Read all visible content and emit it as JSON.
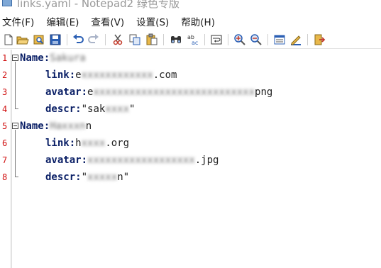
{
  "window": {
    "title": "links.yaml - Notepad2 绿色专版"
  },
  "menubar": {
    "items": [
      {
        "label": "文件(F)"
      },
      {
        "label": "编辑(E)"
      },
      {
        "label": "查看(V)"
      },
      {
        "label": "设置(S)"
      },
      {
        "label": "帮助(H)"
      }
    ]
  },
  "toolbar": {
    "buttons": [
      {
        "name": "new-icon"
      },
      {
        "name": "open-icon"
      },
      {
        "name": "browse-icon"
      },
      {
        "name": "save-icon"
      },
      {
        "name": "undo-icon"
      },
      {
        "name": "redo-icon"
      },
      {
        "name": "cut-icon"
      },
      {
        "name": "copy-icon"
      },
      {
        "name": "paste-icon"
      },
      {
        "name": "find-icon"
      },
      {
        "name": "replace-icon"
      },
      {
        "name": "word-wrap-icon"
      },
      {
        "name": "zoom-in-icon"
      },
      {
        "name": "zoom-out-icon"
      },
      {
        "name": "select-scheme-icon"
      },
      {
        "name": "customize-scheme-icon"
      },
      {
        "name": "exit-icon"
      }
    ],
    "colors": {
      "blue": "#2b5fb4",
      "yellow": "#e8b84a",
      "red": "#c23a2a"
    }
  },
  "editor": {
    "line_number_color": "#d01010",
    "key_color": "#0a1f66",
    "lines": [
      {
        "num": "1",
        "key": "Name",
        "colon": ":",
        "value_visible": "",
        "value_blurred": "Sakura",
        "value_tail": ""
      },
      {
        "num": "2",
        "key": "link",
        "colon": ":",
        "value_visible": "e",
        "value_blurred": "xxxxxxxxxxxx",
        "value_tail": ".com"
      },
      {
        "num": "3",
        "key": "avatar",
        "colon": ":",
        "value_visible": "e",
        "value_blurred": "xxxxxxxxxxxxxxxxxxxxxxxxxxx",
        "value_tail": "png"
      },
      {
        "num": "4",
        "key": "descr",
        "colon": ":",
        "value_visible": "\"sak",
        "value_blurred": "xxxx",
        "value_tail": "\""
      },
      {
        "num": "5",
        "key": "Name",
        "colon": ":",
        "value_visible": "",
        "value_blurred": "Haxxxn",
        "value_tail": "n"
      },
      {
        "num": "6",
        "key": "link",
        "colon": ":",
        "value_visible": "h",
        "value_blurred": "xxxx",
        "value_tail": ".org"
      },
      {
        "num": "7",
        "key": "avatar",
        "colon": ":",
        "value_visible": "",
        "value_blurred": "xxxxxxxxxxxxxxxxxx",
        "value_tail": ".jpg"
      },
      {
        "num": "8",
        "key": "descr",
        "colon": ":",
        "value_visible": "\"",
        "value_blurred": "xxxxx",
        "value_tail": "n\""
      }
    ]
  }
}
